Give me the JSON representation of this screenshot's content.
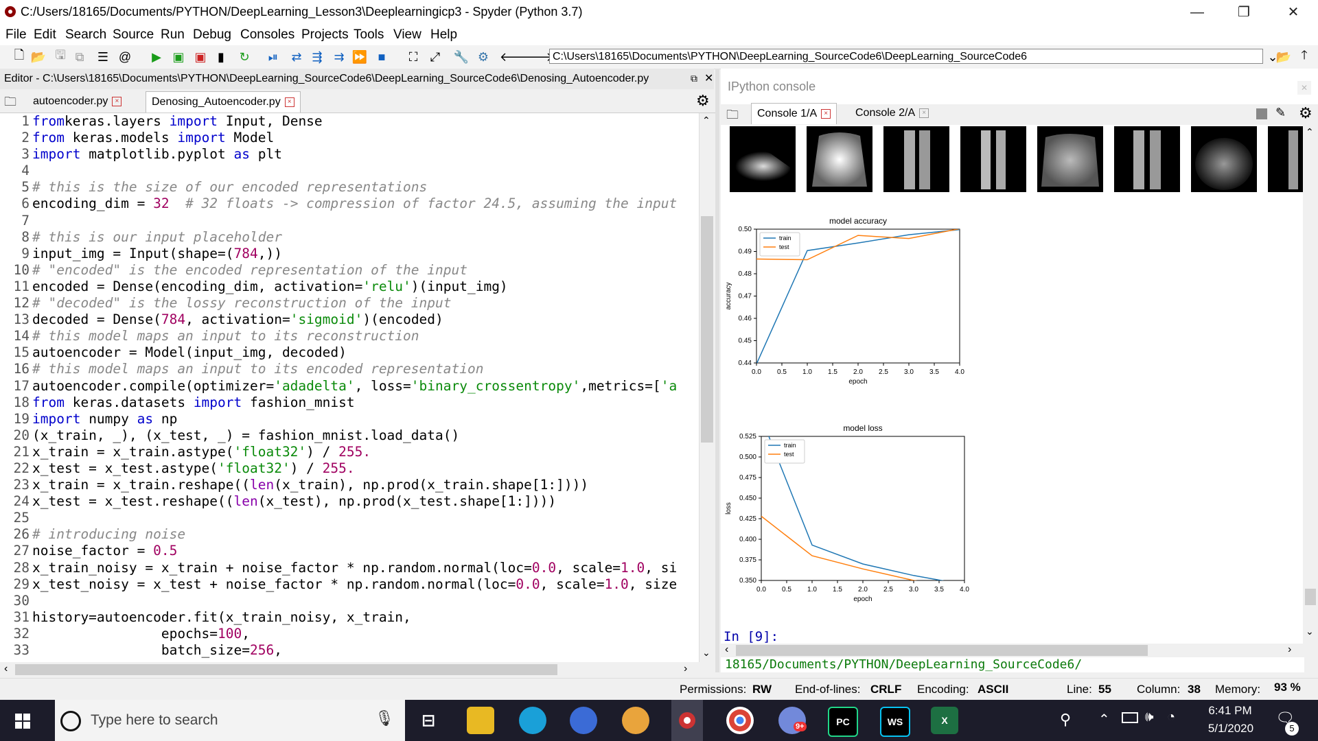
{
  "window": {
    "title": "C:/Users/18165/Documents/PYTHON/DeepLearning_Lesson3\\Deeplearningicp3 - Spyder (Python 3.7)",
    "controls": {
      "minimize": "—",
      "restore": "❐",
      "close": "✕"
    }
  },
  "menu": [
    "File",
    "Edit",
    "Search",
    "Source",
    "Run",
    "Debug",
    "Consoles",
    "Projects",
    "Tools",
    "View",
    "Help"
  ],
  "toolbar": {
    "path": "C:\\Users\\18165\\Documents\\PYTHON\\DeepLearning_SourceCode6\\DeepLearning_SourceCode6"
  },
  "editor": {
    "header": "Editor - C:\\Users\\18165\\Documents\\PYTHON\\DeepLearning_SourceCode6\\DeepLearning_SourceCode6\\Denosing_Autoencoder.py",
    "tabs": [
      {
        "label": "autoencoder.py",
        "active": false
      },
      {
        "label": "Denosing_Autoencoder.py",
        "active": true
      }
    ],
    "line_numbers": [
      "1",
      "2",
      "3",
      "4",
      "5",
      "6",
      "7",
      "8",
      "9",
      "10",
      "11",
      "12",
      "13",
      "14",
      "15",
      "16",
      "17",
      "18",
      "19",
      "20",
      "21",
      "22",
      "23",
      "24",
      "25",
      "26",
      "27",
      "28",
      "29",
      "30",
      "31",
      "32",
      "33"
    ],
    "lines": [
      [
        [
          "kw",
          "from"
        ],
        [
          "",
          "keras.layers "
        ],
        [
          "kw",
          "import"
        ],
        [
          "",
          " Input, Dense"
        ]
      ],
      [
        [
          "kw",
          "from"
        ],
        [
          "",
          " keras.models "
        ],
        [
          "kw",
          "import"
        ],
        [
          "",
          " Model"
        ]
      ],
      [
        [
          "kw",
          "import"
        ],
        [
          "",
          " matplotlib.pyplot "
        ],
        [
          "kw",
          "as"
        ],
        [
          "",
          " plt"
        ]
      ],
      [],
      [
        [
          "cm",
          "# this is the size of our encoded representations"
        ]
      ],
      [
        [
          "",
          "encoding_dim = "
        ],
        [
          "nm",
          "32"
        ],
        [
          "",
          "  "
        ],
        [
          "cm",
          "# 32 floats -> compression of factor 24.5, assuming the input"
        ]
      ],
      [],
      [
        [
          "cm",
          "# this is our input placeholder"
        ]
      ],
      [
        [
          "",
          "input_img = Input(shape=("
        ],
        [
          "nm",
          "784"
        ],
        [
          "",
          ",))"
        ]
      ],
      [
        [
          "cm",
          "# \"encoded\" is the encoded representation of the input"
        ]
      ],
      [
        [
          "",
          "encoded = Dense(encoding_dim, activation="
        ],
        [
          "st",
          "'relu'"
        ],
        [
          "",
          ")(input_img)"
        ]
      ],
      [
        [
          "cm",
          "# \"decoded\" is the lossy reconstruction of the input"
        ]
      ],
      [
        [
          "",
          "decoded = Dense("
        ],
        [
          "nm",
          "784"
        ],
        [
          "",
          ", activation="
        ],
        [
          "st",
          "'sigmoid'"
        ],
        [
          "",
          ")(encoded)"
        ]
      ],
      [
        [
          "cm",
          "# this model maps an input to its reconstruction"
        ]
      ],
      [
        [
          "",
          "autoencoder = Model(input_img, decoded)"
        ]
      ],
      [
        [
          "cm",
          "# this model maps an input to its encoded representation"
        ]
      ],
      [
        [
          "",
          "autoencoder.compile(optimizer="
        ],
        [
          "st",
          "'adadelta'"
        ],
        [
          "",
          ", loss="
        ],
        [
          "st",
          "'binary_crossentropy'"
        ],
        [
          "",
          ",metrics=["
        ],
        [
          "st",
          "'a"
        ]
      ],
      [
        [
          "kw",
          "from"
        ],
        [
          "",
          " keras.datasets "
        ],
        [
          "kw",
          "import"
        ],
        [
          "",
          " fashion_mnist"
        ]
      ],
      [
        [
          "kw",
          "import"
        ],
        [
          "",
          " numpy "
        ],
        [
          "kw",
          "as"
        ],
        [
          "",
          " np"
        ]
      ],
      [
        [
          "",
          "(x_train, _), (x_test, _) = fashion_mnist.load_data()"
        ]
      ],
      [
        [
          "",
          "x_train = x_train.astype("
        ],
        [
          "st",
          "'float32'"
        ],
        [
          "",
          ") / "
        ],
        [
          "nm",
          "255."
        ]
      ],
      [
        [
          "",
          "x_test = x_test.astype("
        ],
        [
          "st",
          "'float32'"
        ],
        [
          "",
          ") / "
        ],
        [
          "nm",
          "255."
        ]
      ],
      [
        [
          "",
          "x_train = x_train.reshape(("
        ],
        [
          "bi",
          "len"
        ],
        [
          "",
          "(x_train), np.prod(x_train.shape[1:])))"
        ]
      ],
      [
        [
          "",
          "x_test = x_test.reshape(("
        ],
        [
          "bi",
          "len"
        ],
        [
          "",
          "(x_test), np.prod(x_test.shape[1:])))"
        ]
      ],
      [],
      [
        [
          "cm",
          "# introducing noise"
        ]
      ],
      [
        [
          "",
          "noise_factor = "
        ],
        [
          "nm",
          "0.5"
        ]
      ],
      [
        [
          "",
          "x_train_noisy = x_train + noise_factor * np.random.normal(loc="
        ],
        [
          "nm",
          "0.0"
        ],
        [
          "",
          ", scale="
        ],
        [
          "nm",
          "1.0"
        ],
        [
          "",
          ", si"
        ]
      ],
      [
        [
          "",
          "x_test_noisy = x_test + noise_factor * np.random.normal(loc="
        ],
        [
          "nm",
          "0.0"
        ],
        [
          "",
          ", scale="
        ],
        [
          "nm",
          "1.0"
        ],
        [
          "",
          ", size"
        ]
      ],
      [],
      [
        [
          "",
          "history=autoencoder.fit(x_train_noisy, x_train,"
        ]
      ],
      [
        [
          "",
          "                epochs="
        ],
        [
          "nm",
          "100"
        ],
        [
          "",
          ","
        ]
      ],
      [
        [
          "",
          "                batch_size="
        ],
        [
          "nm",
          "256"
        ],
        [
          "",
          ","
        ]
      ]
    ]
  },
  "console": {
    "pane_title": "IPython console",
    "tabs": [
      {
        "label": "Console 1/A",
        "active": true
      },
      {
        "label": "Console 2/A",
        "active": false
      }
    ],
    "prompt": "In [9]:",
    "bottom_text": "18165/Documents/PYTHON/DeepLearning_SourceCode6/"
  },
  "chart_data": [
    {
      "type": "line",
      "title": "model accuracy",
      "xlabel": "epoch",
      "ylabel": "accuracy",
      "x": [
        0,
        1,
        2,
        3,
        4
      ],
      "xticks": [
        "0.0",
        "0.5",
        "1.0",
        "1.5",
        "2.0",
        "2.5",
        "3.0",
        "3.5",
        "4.0"
      ],
      "yticks": [
        "0.44",
        "0.45",
        "0.46",
        "0.47",
        "0.48",
        "0.49",
        "0.50"
      ],
      "xlim": [
        0,
        4
      ],
      "ylim": [
        0.44,
        0.5
      ],
      "series": [
        {
          "name": "train",
          "color": "#1f77b4",
          "values": [
            0.4395,
            0.4904,
            0.4938,
            0.4975,
            0.4998
          ]
        },
        {
          "name": "test",
          "color": "#ff7f0e",
          "values": [
            0.4866,
            0.4863,
            0.4972,
            0.4958,
            0.5002
          ]
        }
      ],
      "legend": "upper-left"
    },
    {
      "type": "line",
      "title": "model loss",
      "xlabel": "epoch",
      "ylabel": "loss",
      "x": [
        0,
        1,
        2,
        3,
        4
      ],
      "xticks": [
        "0.0",
        "0.5",
        "1.0",
        "1.5",
        "2.0",
        "2.5",
        "3.0",
        "3.5",
        "4.0"
      ],
      "yticks": [
        "0.350",
        "0.375",
        "0.400",
        "0.425",
        "0.450",
        "0.475",
        "0.500",
        "0.525"
      ],
      "xlim": [
        0,
        4
      ],
      "ylim": [
        0.35,
        0.525
      ],
      "series": [
        {
          "name": "train",
          "color": "#1f77b4",
          "values": [
            0.548,
            0.393,
            0.37,
            0.356,
            0.345
          ]
        },
        {
          "name": "test",
          "color": "#ff7f0e",
          "values": [
            0.428,
            0.38,
            0.364,
            0.35,
            0.342
          ]
        }
      ],
      "legend": "upper-left"
    }
  ],
  "statusbar": {
    "permissions_label": "Permissions:",
    "permissions": "RW",
    "eol_label": "End-of-lines:",
    "eol": "CRLF",
    "encoding_label": "Encoding:",
    "encoding": "ASCII",
    "line_label": "Line:",
    "line": "55",
    "column_label": "Column:",
    "column": "38",
    "memory_label": "Memory:",
    "memory": "93 %"
  },
  "taskbar": {
    "search_placeholder": "Type here to search",
    "time": "6:41 PM",
    "date": "5/1/2020",
    "notifications": "5",
    "apps": [
      "task-view",
      "file-explorer",
      "edge",
      "chrome",
      "chrome-canary",
      "spyder",
      "chrome-2",
      "discord",
      "pycharm",
      "webstorm",
      "excel"
    ],
    "app_labels": {
      "pycharm": "PC",
      "webstorm": "WS",
      "excel": "X",
      "discord_badge": "9+"
    }
  }
}
